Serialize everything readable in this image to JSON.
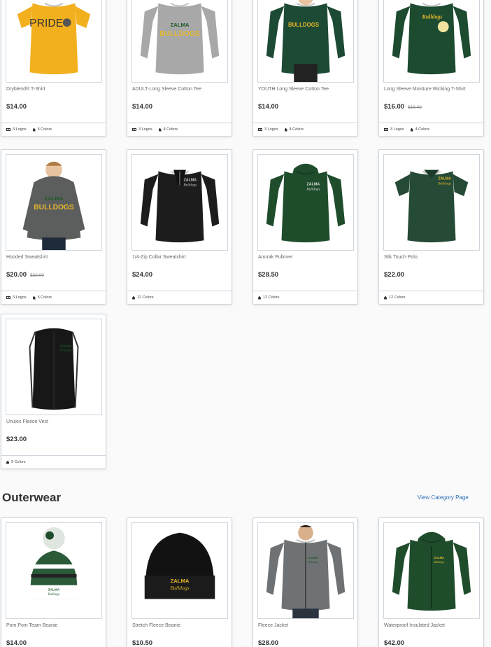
{
  "products_top": [
    {
      "name": "Dryblend® T-Shirt",
      "price": "$14.00",
      "old_price": "",
      "logos": "3 Logos",
      "colors": "5 Colors",
      "image": "gold-tshirt"
    },
    {
      "name": "ADULT-Long Sleeve Cotton Tee",
      "price": "$14.00",
      "old_price": "",
      "logos": "3 Logos",
      "colors": "4 Colors",
      "image": "gray-longsleeve"
    },
    {
      "name": "YOUTH Long Sleeve Cotton Tee",
      "price": "$14.00",
      "old_price": "",
      "logos": "3 Logos",
      "colors": "4 Colors",
      "image": "green-youth-tee"
    },
    {
      "name": "Long Sleeve Moisture Wicking T-Shirt",
      "price": "$16.00",
      "old_price": "$18.00",
      "logos": "3 Logos",
      "colors": "4 Colors",
      "image": "green-wicking-tee"
    },
    {
      "name": "Hooded Sweatshirt",
      "price": "$20.00",
      "old_price": "$22.00",
      "logos": "3 Logos",
      "colors": "5 Colors",
      "image": "gray-hoodie"
    },
    {
      "name": "1/4-Zip Collar Sweatshirt",
      "price": "$24.00",
      "old_price": "",
      "logos": "",
      "colors": "12 Colors",
      "image": "black-quarter-zip"
    },
    {
      "name": "Anorak Pullover",
      "price": "$28.50",
      "old_price": "",
      "logos": "",
      "colors": "12 Colors",
      "image": "green-anorak"
    },
    {
      "name": "Silk Touch Polo",
      "price": "$22.00",
      "old_price": "",
      "logos": "",
      "colors": "12 Colors",
      "image": "green-polo"
    },
    {
      "name": "Unisex Fleece Vest",
      "price": "$23.00",
      "old_price": "",
      "logos": "",
      "colors": "9 Colors",
      "image": "black-vest"
    }
  ],
  "outerwear": {
    "title": "Outerwear",
    "view_link": "View Category Page",
    "products": [
      {
        "name": "Pom Pom Team Beanie",
        "price": "$14.00",
        "image": "pom-beanie"
      },
      {
        "name": "Stretch Fleece Beanie",
        "price": "$10.50",
        "image": "black-beanie"
      },
      {
        "name": "Fleece Jacket",
        "price": "$28.00",
        "image": "gray-fleece-jacket"
      },
      {
        "name": "Waterproof Insulated Jacket",
        "price": "$42.00",
        "image": "green-insulated-jacket"
      }
    ]
  },
  "images": {
    "pride_text": "PRIDE",
    "zalma_text": "ZALMA",
    "bulldogs_text": "BULLDOGS",
    "bulldogs_script": "Bulldogs"
  },
  "colors": {
    "link": "#2a6ebb",
    "border": "#cfd6dd",
    "school_green": "#1f5a2a",
    "school_gold": "#e6b82a"
  }
}
